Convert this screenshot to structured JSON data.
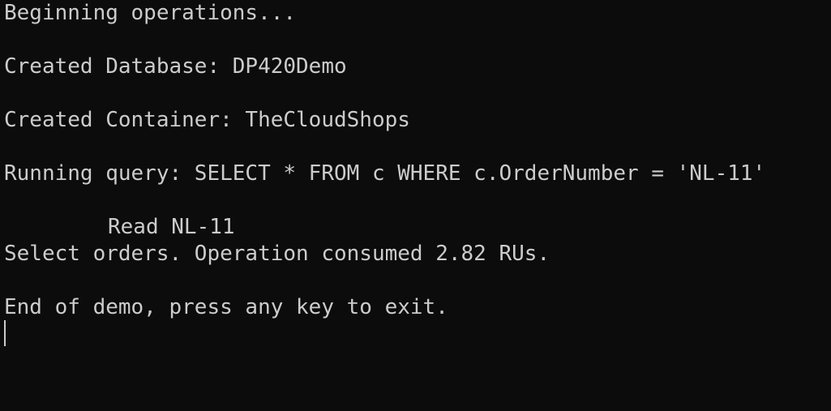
{
  "terminal": {
    "lines": {
      "l0": "Beginning operations...",
      "l1": "",
      "l2": "Created Database: DP420Demo",
      "l3": "",
      "l4": "Created Container: TheCloudShops",
      "l5": "",
      "l6": "Running query: SELECT * FROM c WHERE c.OrderNumber = 'NL-11'",
      "l7": "",
      "l8": "Read NL-11",
      "l9": "Select orders. Operation consumed 2.82 RUs.",
      "l10": "",
      "l11": "End of demo, press any key to exit."
    },
    "colors": {
      "background": "#0c0c0c",
      "foreground": "#cccccc"
    }
  }
}
